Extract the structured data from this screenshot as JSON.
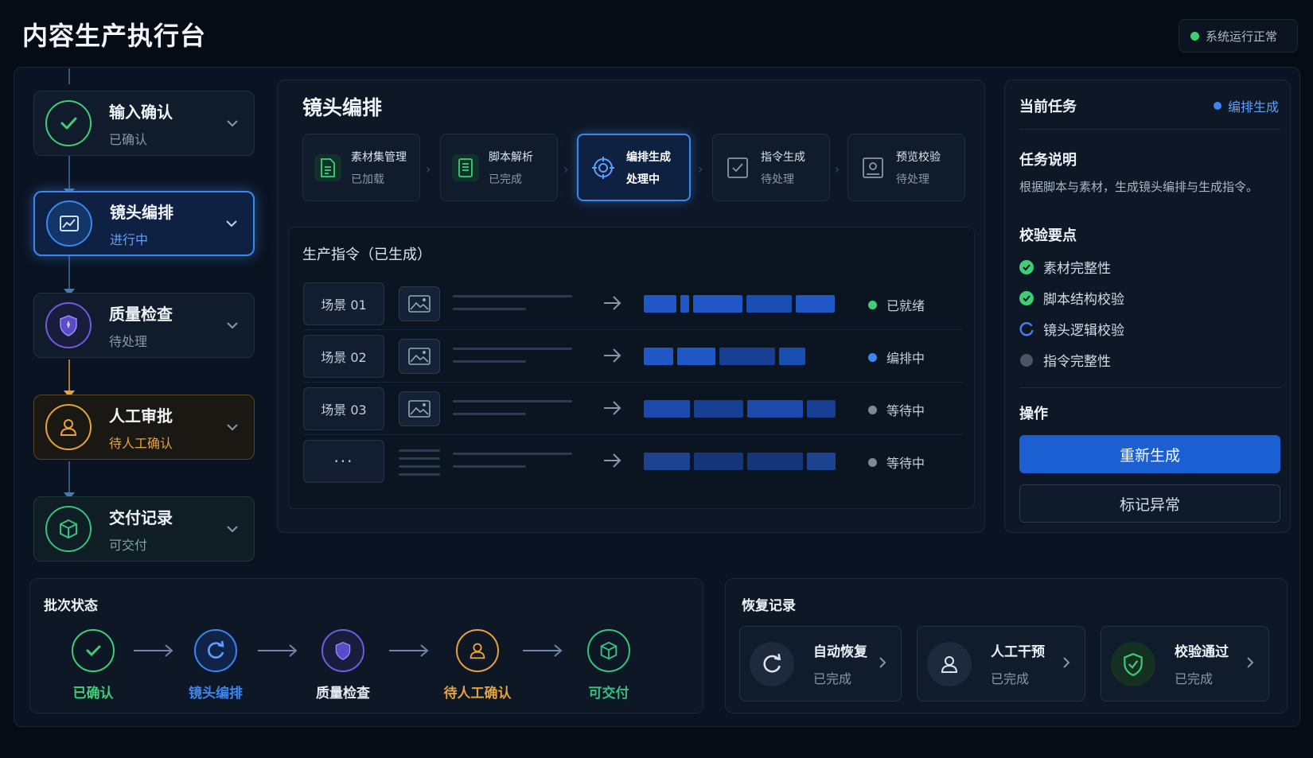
{
  "app_title": "内容生产执行台",
  "system_status": {
    "label": "系统运行正常",
    "color": "#3ecf76"
  },
  "stepper": [
    {
      "name": "输入确认",
      "status": "已确认",
      "icon": "check-icon",
      "color": "#3ecf76"
    },
    {
      "name": "镜头编排",
      "status": "进行中",
      "icon": "storyboard-icon",
      "color": "#3d86f0"
    },
    {
      "name": "质量检查",
      "status": "待处理",
      "icon": "shield-icon",
      "color": "#6d5ce0"
    },
    {
      "name": "人工审批",
      "status": "待人工确认",
      "icon": "user-icon",
      "color": "#e6a23c"
    },
    {
      "name": "交付记录",
      "status": "可交付",
      "icon": "box-icon",
      "color": "#35c27e"
    }
  ],
  "main": {
    "title": "镜头编排",
    "sub_steps": [
      {
        "name": "素材集管理",
        "status": "已加载",
        "icon": "document-icon",
        "active": false
      },
      {
        "name": "脚本解析",
        "status": "已完成",
        "icon": "script-icon",
        "active": false
      },
      {
        "name": "编排生成",
        "status": "处理中",
        "icon": "target-icon",
        "active": true
      },
      {
        "name": "指令生成",
        "status": "待处理",
        "icon": "checkbox-icon",
        "active": false
      },
      {
        "name": "预览校验",
        "status": "待处理",
        "icon": "preview-icon",
        "active": false
      }
    ],
    "instructions_title": "生产指令（已生成）",
    "rows": [
      {
        "scene": "场景 01",
        "status": "已就绪",
        "status_color": "#3ecf76"
      },
      {
        "scene": "场景 02",
        "status": "编排中",
        "status_color": "#3d86f0"
      },
      {
        "scene": "场景 03",
        "status": "等待中",
        "status_color": "#7e8896"
      },
      {
        "scene": "···",
        "status": "等待中",
        "status_color": "#7e8896"
      }
    ]
  },
  "task": {
    "heading": "当前任务",
    "badge": "编排生成",
    "desc_title": "任务说明",
    "desc": "根据脚本与素材，生成镜头编排与生成指令。",
    "checks_title": "校验要点",
    "checks": [
      {
        "label": "素材完整性",
        "state": "done"
      },
      {
        "label": "脚本结构校验",
        "state": "done"
      },
      {
        "label": "镜头逻辑校验",
        "state": "running"
      },
      {
        "label": "指令完整性",
        "state": "pending"
      }
    ],
    "actions_title": "操作",
    "primary_button": "重新生成",
    "secondary_button": "标记异常"
  },
  "batch": {
    "title": "批次状态",
    "steps": [
      {
        "label": "已确认",
        "color": "#3ecf76"
      },
      {
        "label": "镜头编排",
        "color": "#3d86f0"
      },
      {
        "label": "质量检查",
        "color": "#6d5ce0"
      },
      {
        "label": "待人工确认",
        "color": "#e6a23c"
      },
      {
        "label": "可交付",
        "color": "#35c27e"
      }
    ]
  },
  "recovery": {
    "title": "恢复记录",
    "items": [
      {
        "name": "自动恢复",
        "status": "已完成",
        "icon": "refresh-icon"
      },
      {
        "name": "人工干预",
        "status": "已完成",
        "icon": "user-icon"
      },
      {
        "name": "校验通过",
        "status": "已完成",
        "icon": "shield-check-icon"
      }
    ]
  }
}
